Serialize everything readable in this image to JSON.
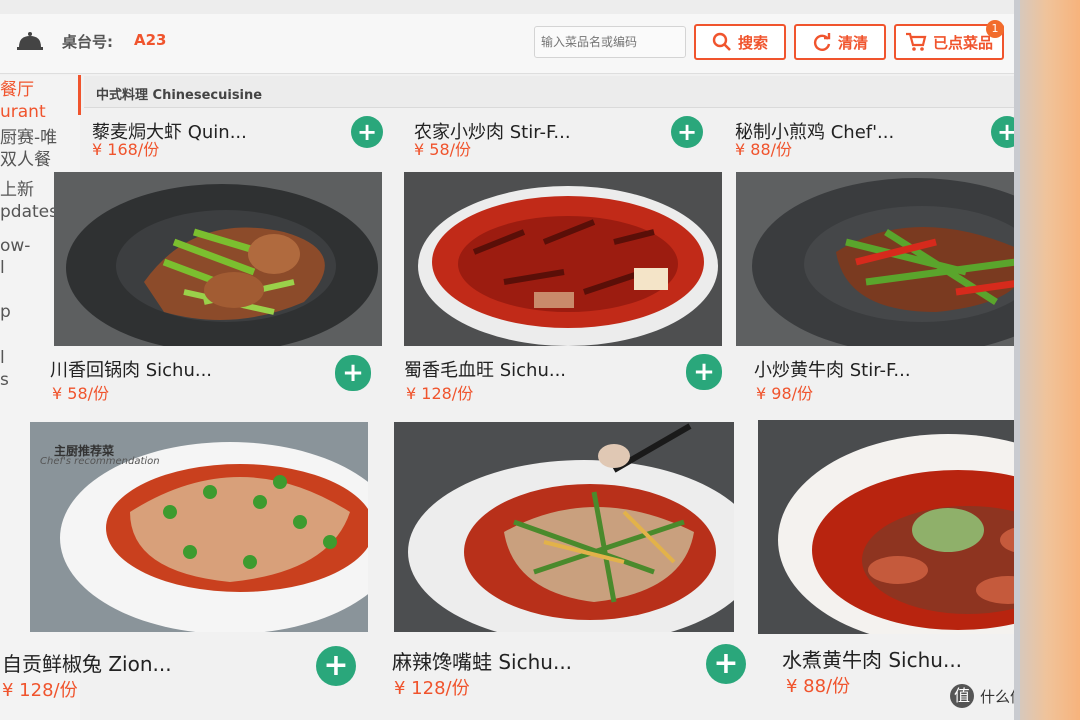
{
  "topbar": {
    "table_label": "桌台号:",
    "table_value": "A23",
    "search_placeholder": "输入菜品名或编码",
    "search_button": "搜索",
    "clear_button": "清清",
    "ordered_button": "已点菜品",
    "ordered_count": "1"
  },
  "sidebar": {
    "items": [
      "餐厅",
      "urant",
      "厨赛-唯",
      "双人餐",
      "上新",
      "pdates",
      "ow-",
      "l",
      "p",
      "l",
      "s"
    ]
  },
  "category": {
    "title": "中式料理 Chinesecuisine"
  },
  "top_row": [
    {
      "name": "藜麦焗大虾 Quin...",
      "price": "¥ 168/份"
    },
    {
      "name": "农家小炒肉 Stir-F...",
      "price": "¥ 58/份"
    },
    {
      "name": "秘制小煎鸡 Chef'...",
      "price": "¥ 88/份"
    }
  ],
  "middle_row": [
    {
      "name": "川香回锅肉 Sichu...",
      "price": "¥ 58/份"
    },
    {
      "name": "蜀香毛血旺 Sichu...",
      "price": "¥ 128/份"
    },
    {
      "name": "小炒黄牛肉 Stir-F...",
      "price": "¥ 98/份"
    }
  ],
  "bottom_row": [
    {
      "name": "自贡鲜椒兔 Zion...",
      "price": "¥ 128/份"
    },
    {
      "name": "麻辣馋嘴蛙 Sichu...",
      "price": "¥ 128/份"
    },
    {
      "name": "水煮黄牛肉 Sichu...",
      "price": "¥ 88/份"
    }
  ],
  "chef_tag": {
    "title": "主厨推荐菜",
    "subtitle": "Chef's recommendation"
  },
  "add_symbol": "+",
  "watermark": {
    "logo": "值",
    "text": "什么值得买"
  },
  "colors": {
    "accent": "#f0542d",
    "add": "#2aa77b"
  }
}
